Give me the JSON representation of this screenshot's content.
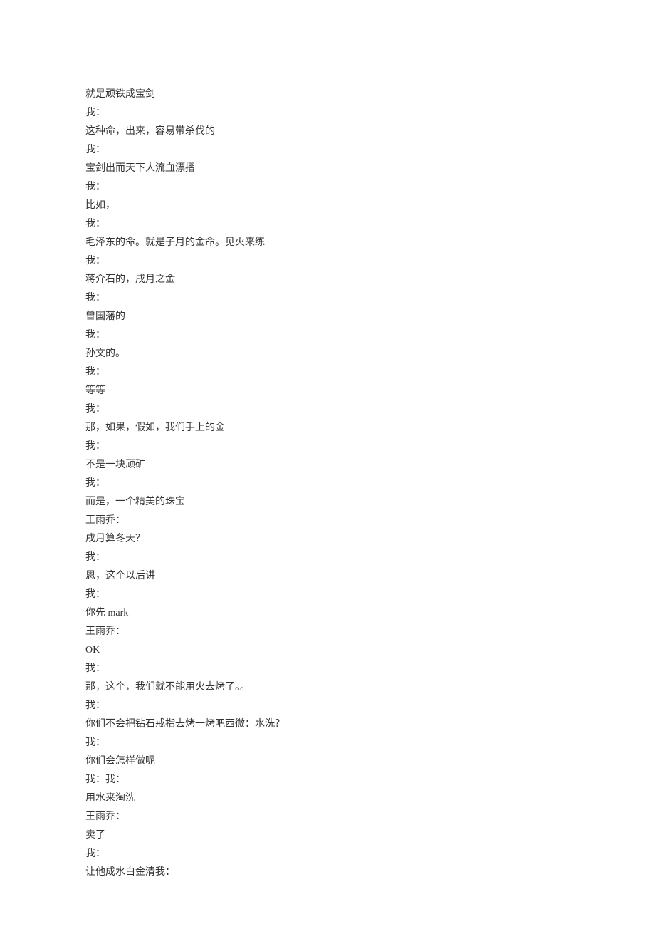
{
  "lines": [
    "就是顽铁成宝剑",
    "我：",
    "这种命，出来，容易带杀伐的",
    "我：",
    "宝剑出而天下人流血漂摺",
    "我：",
    "比如，",
    "我：",
    "毛泽东的命。就是子月的金命。见火来练",
    "我：",
    "蒋介石的，戌月之金",
    "我：",
    "曾国藩的",
    "我：",
    "孙文的。",
    "我：",
    "等等",
    "我：",
    "那，如果，假如，我们手上的金",
    "我：",
    "不是一块顽矿",
    "我：",
    "而是，一个精美的珠宝",
    "王雨乔：",
    "戌月算冬天？",
    "我：",
    "恩，这个以后讲",
    "我：",
    "你先 mark",
    "王雨乔：",
    "OK",
    "我：",
    "那，这个，我们就不能用火去烤了。。",
    "我：",
    "你们不会把钻石戒指去烤一烤吧西微：水洗？",
    "我：",
    "你们会怎样做呢",
    "我：我：",
    "用水来淘洗",
    "王雨乔：",
    "卖了",
    "我：",
    "让他成水白金清我："
  ]
}
